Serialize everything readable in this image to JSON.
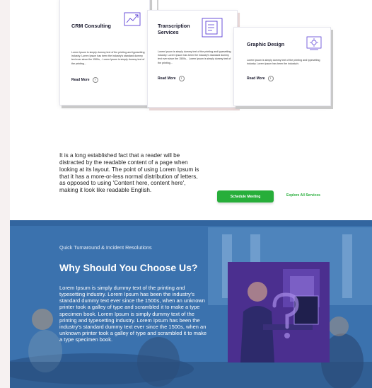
{
  "services": [
    {
      "title": "CRM Consulting",
      "description": "Lorem Ipsum is simply dummy text of the printing and typesetting industry. Lorem Ipsum has been the industry's standard dummy text ever since the 1500s, . Lorem Ipsum is simply dummy text of the printing...",
      "read_more": "Read More",
      "icon": "crm-icon"
    },
    {
      "title": "Transcription Services",
      "description": "Lorem Ipsum is simply dummy text of the printing and typesetting industry. Lorem Ipsum has been the industry's standard dummy text ever since the 1500s, . Lorem Ipsum is simply dummy text of the printing...",
      "read_more": "Read More",
      "icon": "transcription-icon"
    },
    {
      "title": "Graphic Design",
      "description": "Lorem Ipsum is simply dummy text of the printing and typesetting industry. Lorem Ipsum has been the industry's",
      "read_more": "Read More",
      "icon": "graphic-design-icon"
    }
  ],
  "about": {
    "text": "It is a long established fact that a reader will be distracted by the readable content of a page when looking at its layout. The point of using Lorem Ipsum is that it has a more-or-less normal distribution of letters, as opposed to using 'Content here, content here', making it look like readable English.",
    "schedule_button": "Schedule Meeting",
    "explore_link": "Explore All Services"
  },
  "why": {
    "kicker": "Quick Turnaround & Incident Resolutions",
    "title": "Why Should You Choose Us?",
    "body": "Lorem Ipsum is simply dummy text of the printing and typesetting industry. Lorem Ipsum has been the industry's standard dummy text ever since the 1500s, when an unknown printer took a galley of type and scrambled it to make a type specimen book. Lorem Ipsum is simply dummy text of the printing and typesetting industry. Lorem Ipsum has been the industry's standard dummy text ever since the 1500s, when an unknown printer took a galley of type and scrambled it to make a type specimen book."
  },
  "colors": {
    "accent_green": "#27ae3a",
    "icon_purple": "#5b3fd6",
    "section_blue": "#3f78b5",
    "photo_overlay": "#4a2f8c"
  }
}
